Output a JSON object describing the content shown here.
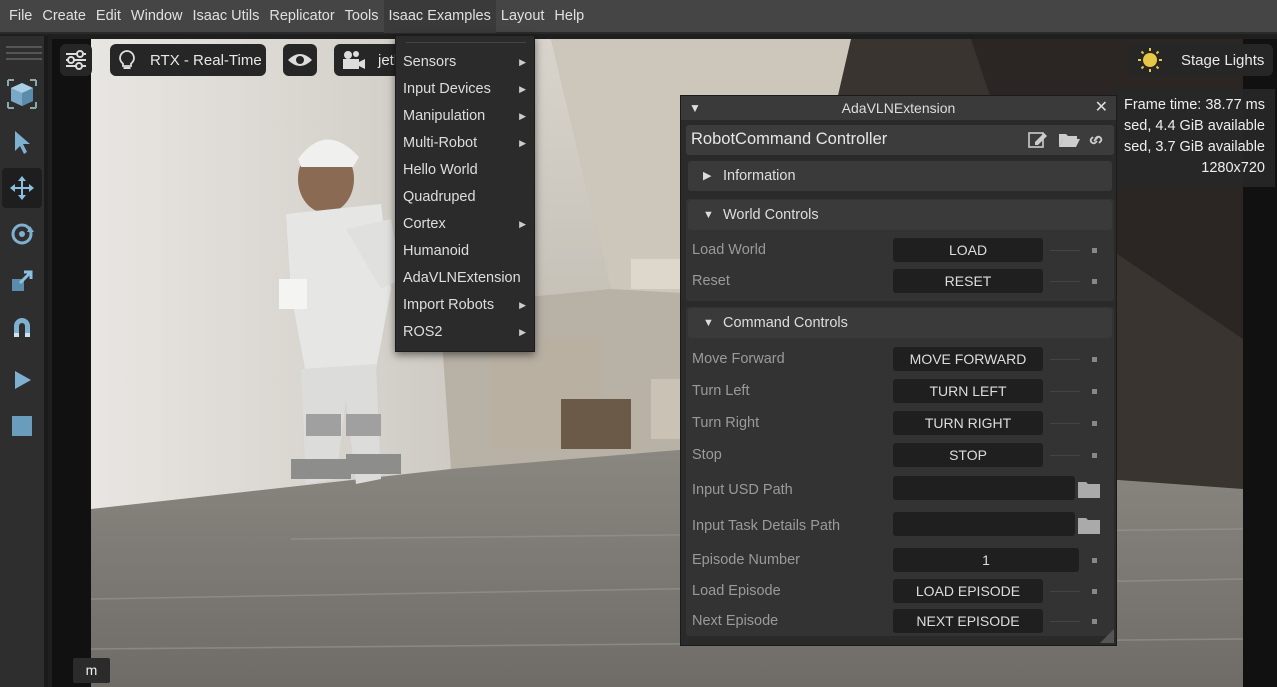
{
  "menubar": {
    "items": [
      "File",
      "Create",
      "Edit",
      "Window",
      "Isaac Utils",
      "Replicator",
      "Tools",
      "Isaac Examples",
      "Layout",
      "Help"
    ]
  },
  "viewport": {
    "renderer": "RTX - Real-Time",
    "camera": "jetl",
    "stage_lights": "Stage Lights",
    "stats": {
      "frame_time": "Frame time: 38.77 ms",
      "mem1": "sed, 4.4 GiB available",
      "mem2": "sed, 3.7 GiB available",
      "resolution": "1280x720"
    },
    "hotkey_badge": "m"
  },
  "examples_menu": {
    "items": [
      {
        "label": "Sensors",
        "submenu": true
      },
      {
        "label": "Input Devices",
        "submenu": true
      },
      {
        "label": "Manipulation",
        "submenu": true
      },
      {
        "label": "Multi-Robot",
        "submenu": true
      },
      {
        "label": "Hello World",
        "submenu": false
      },
      {
        "label": "Quadruped",
        "submenu": false
      },
      {
        "label": "Cortex",
        "submenu": true
      },
      {
        "label": "Humanoid",
        "submenu": false
      },
      {
        "label": "AdaVLNExtension",
        "submenu": false
      },
      {
        "label": "Import Robots",
        "submenu": true
      },
      {
        "label": "ROS2",
        "submenu": true
      }
    ]
  },
  "panel": {
    "window_title": "AdaVLNExtension",
    "header": "RobotCommand Controller",
    "information": "Information",
    "world_controls": {
      "title": "World Controls",
      "rows": [
        {
          "label": "Load World",
          "button": "LOAD"
        },
        {
          "label": "Reset",
          "button": "RESET"
        }
      ]
    },
    "command_controls": {
      "title": "Command Controls",
      "rows": [
        {
          "label": "Move Forward",
          "button": "MOVE FORWARD"
        },
        {
          "label": "Turn Left",
          "button": "TURN LEFT"
        },
        {
          "label": "Turn Right",
          "button": "TURN RIGHT"
        },
        {
          "label": "Stop",
          "button": "STOP"
        }
      ],
      "usd_path_label": "Input USD Path",
      "usd_path_value": "",
      "task_path_label": "Input Task Details Path",
      "task_path_value": "",
      "episode_label": "Episode Number",
      "episode_value": "1",
      "load_episode_label": "Load Episode",
      "load_episode_button": "LOAD EPISODE",
      "next_episode_label": "Next Episode",
      "next_episode_button": "NEXT EPISODE"
    }
  },
  "colors": {
    "accent": "#e7c845",
    "panel_bg": "#2a2a2a",
    "button_bg": "#1f1f1f"
  }
}
